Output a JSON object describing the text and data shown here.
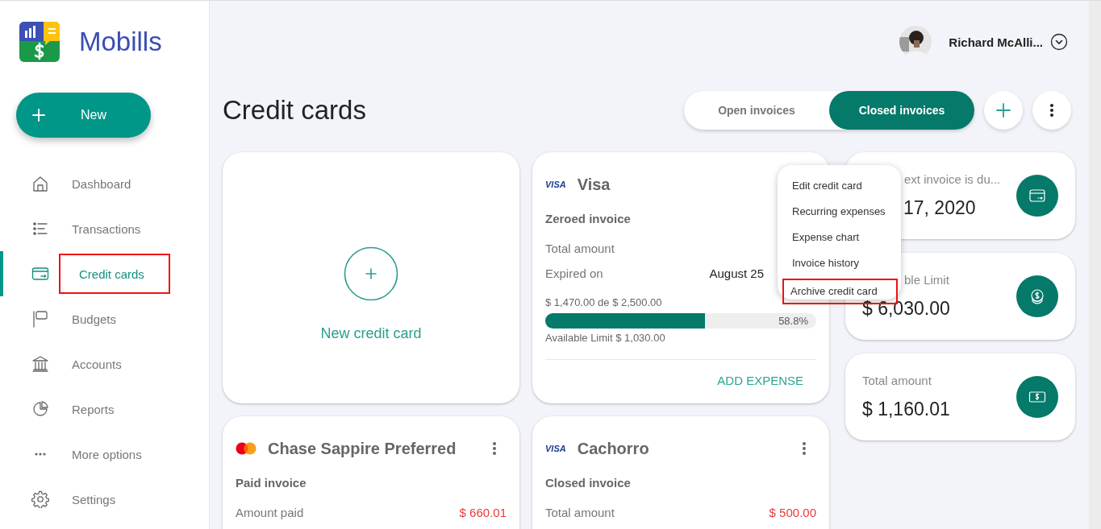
{
  "app": {
    "name": "Mobills"
  },
  "new_button": {
    "label": "New"
  },
  "nav": [
    {
      "label": "Dashboard",
      "kind": "home",
      "selected": false,
      "highlighted": false
    },
    {
      "label": "Transactions",
      "kind": "list",
      "selected": false,
      "highlighted": false
    },
    {
      "label": "Credit cards",
      "kind": "card",
      "selected": true,
      "highlighted": true
    },
    {
      "label": "Budgets",
      "kind": "flag",
      "selected": false,
      "highlighted": false
    },
    {
      "label": "Accounts",
      "kind": "bank",
      "selected": false,
      "highlighted": false
    },
    {
      "label": "Reports",
      "kind": "pie",
      "selected": false,
      "highlighted": false
    },
    {
      "label": "More options",
      "kind": "dots",
      "selected": false,
      "highlighted": false
    },
    {
      "label": "Settings",
      "kind": "gear",
      "selected": false,
      "highlighted": false
    }
  ],
  "user": {
    "name": "Richard McAlli..."
  },
  "page_title": "Credit cards",
  "tabs": [
    {
      "label": "Open invoices",
      "selected": false
    },
    {
      "label": "Closed invoices",
      "selected": true
    }
  ],
  "new_card": {
    "label": "New credit card"
  },
  "cards": [
    {
      "brand": {
        "kind": "visa",
        "text": "VISA"
      },
      "name": "Visa",
      "status": "Zeroed invoice",
      "menu_open": true,
      "rows": [
        {
          "label": "Total amount"
        },
        {
          "label": "Expired on",
          "value": "August 25",
          "color": "#222222"
        }
      ],
      "usage": {
        "text": "$ 1,470.00 de $ 2,500.00",
        "level": 0.588,
        "percent": "58.8%",
        "available": "Available Limit $ 1,030.00"
      },
      "action": "ADD EXPENSE"
    },
    {
      "brand": {
        "kind": "mastercard"
      },
      "name": "Chase Sappire Preferred",
      "status": "Paid invoice",
      "menu_open": false,
      "rows": [
        {
          "label": "Amount paid",
          "value": "$ 660.01",
          "color": "#e83a3a"
        }
      ]
    },
    {
      "brand": {
        "kind": "visa",
        "text": "VISA"
      },
      "name": "Cachorro",
      "status": "Closed invoice",
      "menu_open": false,
      "rows": [
        {
          "label": "Total amount",
          "value": "$ 500.00",
          "color": "#e83a3a"
        }
      ]
    }
  ],
  "card_menu": {
    "items": [
      {
        "label": "Edit credit card",
        "highlighted": false
      },
      {
        "label": "Recurring expenses",
        "highlighted": false
      },
      {
        "label": "Expense chart",
        "highlighted": false
      },
      {
        "label": "Invoice history",
        "highlighted": false
      },
      {
        "label": "Archive credit card",
        "highlighted": true
      }
    ]
  },
  "summary": [
    {
      "kind": "card",
      "label": {
        "text": "ext invoice is du...",
        "covered": true
      },
      "value": {
        "text": "17, 2020",
        "covered": true
      }
    },
    {
      "kind": "coins",
      "label": {
        "text": "ble Limit",
        "covered": true
      },
      "value": {
        "text": "$ 6,030.00"
      }
    },
    {
      "kind": "cash",
      "label": {
        "text": "Total amount"
      },
      "value": {
        "text": "$ 1,160.01"
      }
    }
  ]
}
